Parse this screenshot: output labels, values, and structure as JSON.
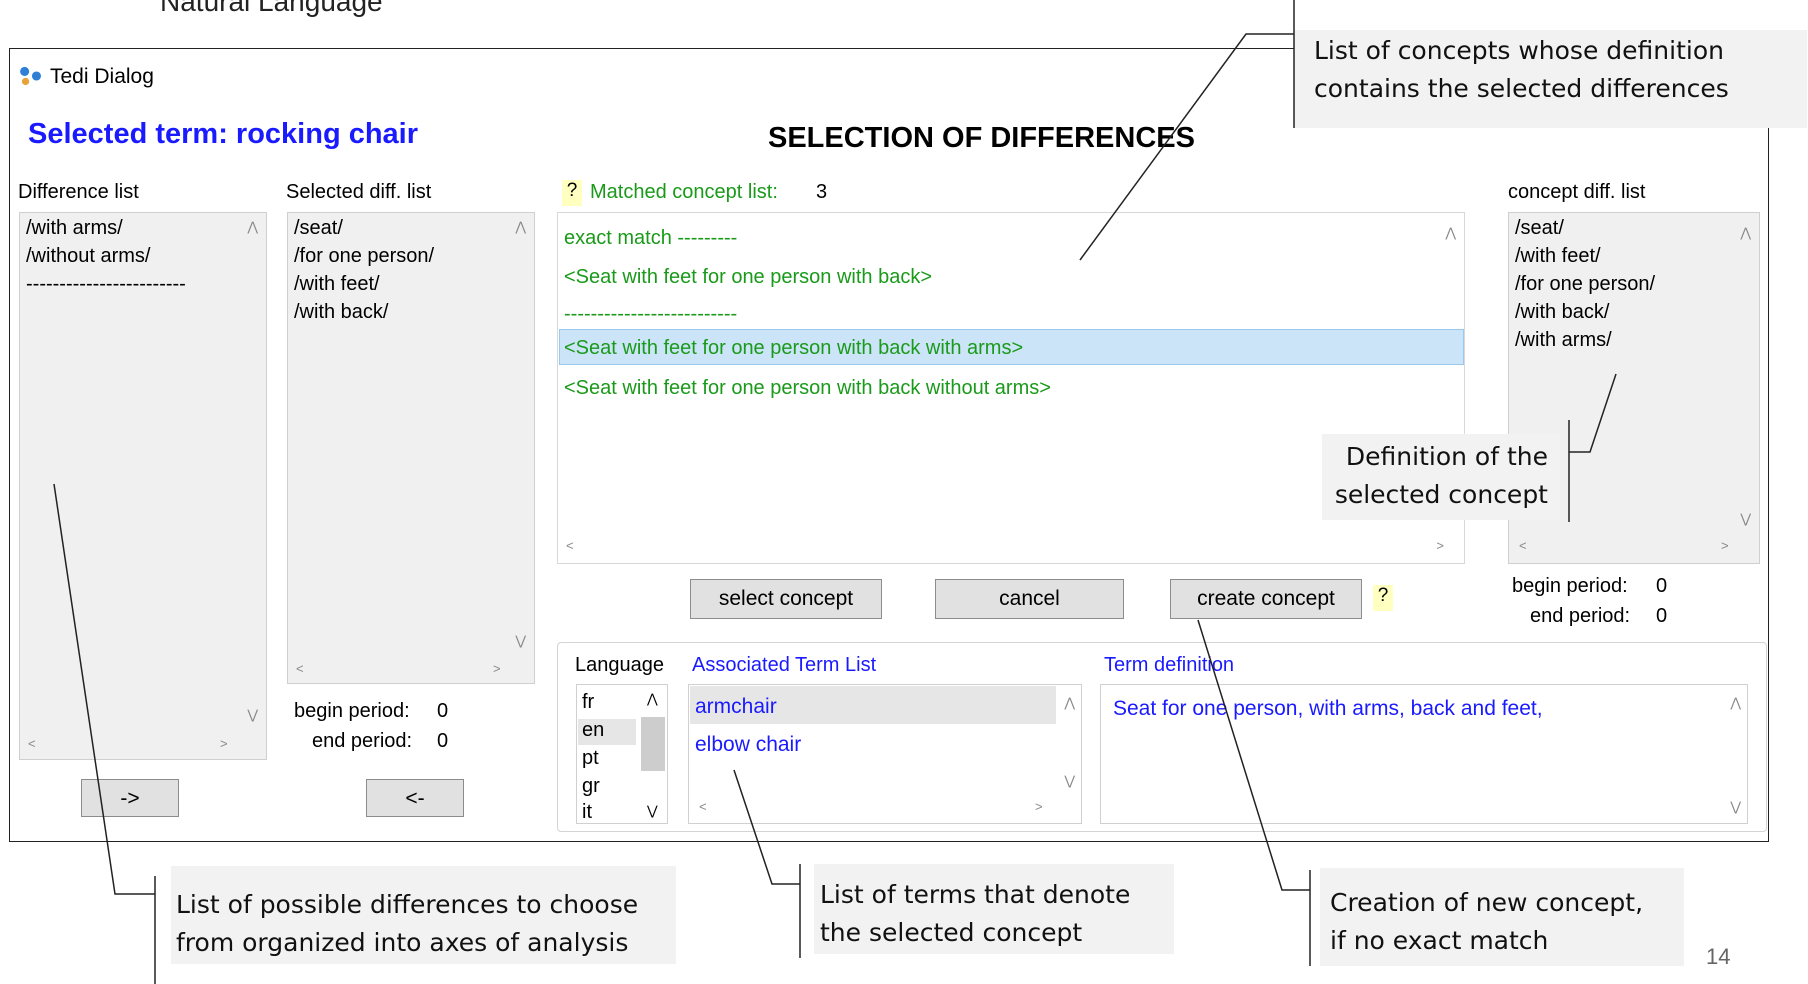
{
  "slide": {
    "heading_fragment": "Natural Language",
    "page_number": "14"
  },
  "window": {
    "title": "Tedi Dialog",
    "icon": "tedi-app-icon"
  },
  "header": {
    "selected_term": "Selected term: rocking chair",
    "section_title": "SELECTION OF DIFFERENCES"
  },
  "difference_list": {
    "label": "Difference list",
    "items": [
      "/with arms/",
      "/without arms/",
      "------------------------"
    ],
    "move_right_label": "->"
  },
  "selected_diff_list": {
    "label": "Selected diff. list",
    "items": [
      "/seat/",
      "/for one person/",
      "/with feet/",
      "/with back/"
    ],
    "begin_period_label": "begin period:",
    "begin_period_value": "0",
    "end_period_label": "end period:",
    "end_period_value": "0",
    "move_left_label": "<-"
  },
  "matched": {
    "help": "?",
    "label": "Matched concept list:",
    "count": "3",
    "items": [
      "exact match ---------",
      "<Seat with feet for one person with back>",
      "--------------------------",
      "<Seat with feet for one person with back with arms>",
      "<Seat with feet for one person with back without arms>"
    ],
    "selected_index": 3
  },
  "buttons": {
    "select": "select concept",
    "cancel": "cancel",
    "create": "create concept",
    "create_help": "?"
  },
  "concept_diff_list": {
    "label": "concept diff. list",
    "items": [
      "/seat/",
      "/with feet/",
      "/for one person/",
      "/with back/",
      "/with arms/"
    ],
    "begin_period_label": "begin period:",
    "begin_period_value": "0",
    "end_period_label": "end period:",
    "end_period_value": "0"
  },
  "language": {
    "label": "Language",
    "items": [
      "fr",
      "en",
      "pt",
      "gr",
      "it"
    ],
    "selected": "en"
  },
  "terms": {
    "label": "Associated Term List",
    "items": [
      "armchair",
      "elbow chair"
    ]
  },
  "definition": {
    "label": "Term definition",
    "text": "Seat for one person, with arms, back and feet,"
  },
  "callouts": {
    "concepts": [
      "List of concepts whose definition",
      "contains the selected differences"
    ],
    "definition": [
      "Definition of the",
      "selected concept"
    ],
    "differences": [
      "List of possible differences to choose",
      "from organized into axes of analysis"
    ],
    "terms": [
      "List of terms that denote",
      "the selected concept"
    ],
    "creation": [
      "Creation of new concept,",
      "if no exact match"
    ]
  }
}
